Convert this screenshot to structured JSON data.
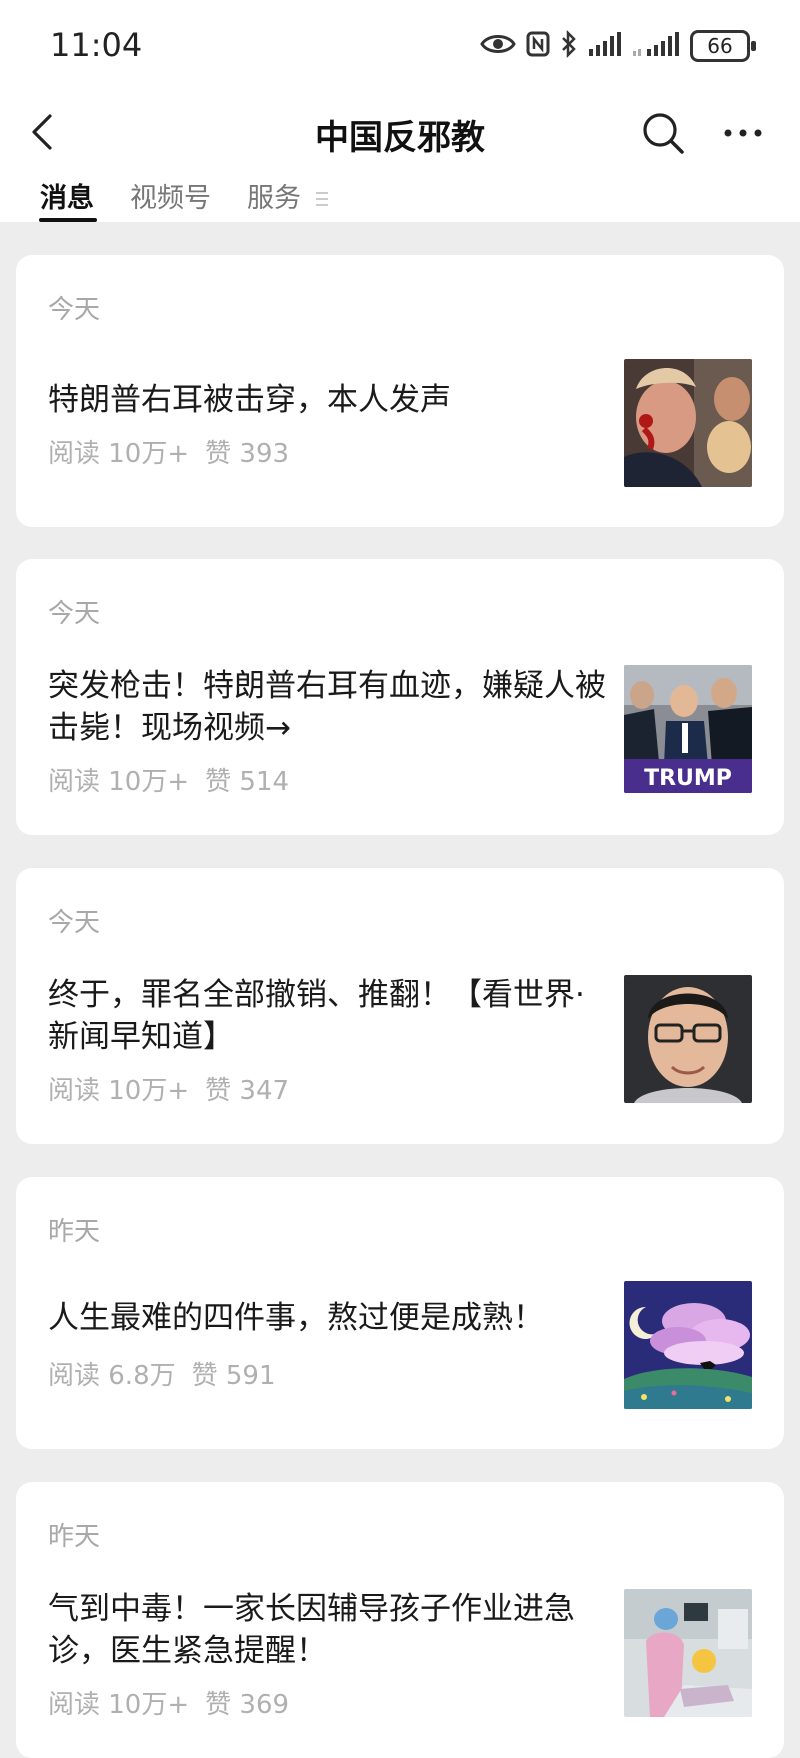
{
  "status_bar": {
    "time": "11:04",
    "battery": "66"
  },
  "header": {
    "title": "中国反邪教",
    "back_icon": "chevron-left-icon",
    "search_icon": "search-icon",
    "more_icon": "more-dots-icon"
  },
  "tabs": [
    {
      "label": "消息",
      "active": true
    },
    {
      "label": "视频号",
      "active": false
    },
    {
      "label": "服务",
      "active": false
    }
  ],
  "articles": [
    {
      "date": "今天",
      "title": "特朗普右耳被击穿，本人发声",
      "reads": "阅读 10万+",
      "likes": "赞 393",
      "thumbnail": "photo-man-with-blood-on-ear"
    },
    {
      "date": "今天",
      "title": "突发枪击！特朗普右耳有血迹，嫌疑人被击毙！现场视频→",
      "reads": "阅读 10万+",
      "likes": "赞 514",
      "thumbnail": "photo-rally-trump-sign",
      "thumb_text": "TRUMP"
    },
    {
      "date": "今天",
      "title": "终于，罪名全部撤销、推翻！【看世界·新闻早知道】",
      "reads": "阅读 10万+",
      "likes": "赞 347",
      "thumbnail": "photo-man-with-glasses"
    },
    {
      "date": "昨天",
      "title": "人生最难的四件事，熬过便是成熟！",
      "reads": "阅读 6.8万",
      "likes": "赞 591",
      "thumbnail": "illustration-moon-clouds-horse"
    },
    {
      "date": "昨天",
      "title": "气到中毒！一家长因辅导孩子作业进急诊，医生紧急提醒！",
      "reads": "阅读 10万+",
      "likes": "赞 369",
      "thumbnail": "photo-hospital-ward"
    }
  ],
  "colors": {
    "background": "#ededed",
    "card": "#ffffff",
    "muted_text": "#a8a8a8"
  }
}
